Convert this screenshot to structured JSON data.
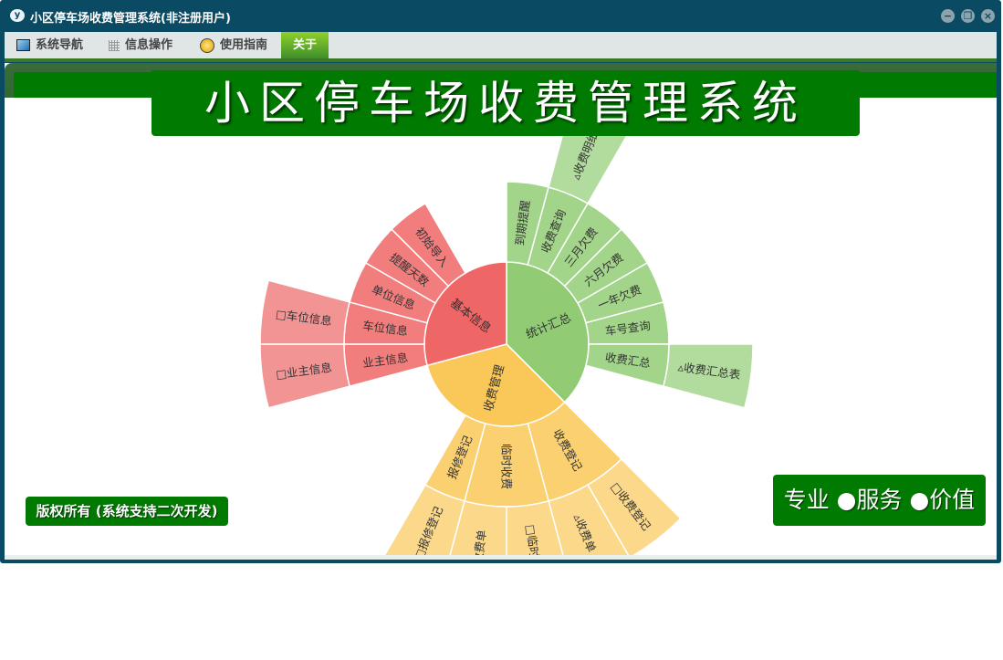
{
  "window": {
    "title": "小区停车场收费管理系统(非注册用户)",
    "controls": [
      "minimize",
      "restore",
      "close"
    ]
  },
  "menu": {
    "items": [
      {
        "label": "系统导航",
        "icon": "monitor-icon"
      },
      {
        "label": "信息操作",
        "icon": "grid-icon"
      },
      {
        "label": "使用指南",
        "icon": "help-icon"
      },
      {
        "label": "关于",
        "active": true
      }
    ]
  },
  "banner": {
    "title": "小区停车场收费管理系统"
  },
  "footer": {
    "copyright": "版权所有 (系统支持二次开发)",
    "slogan": "专业 ●服务 ●价值"
  },
  "chart_data": {
    "type": "sunburst",
    "start": "top, clockwise",
    "nodes": [
      {
        "name": "统计汇总",
        "value": 9,
        "color": "#91cc75",
        "children": [
          {
            "name": "到期提醒",
            "value": 1
          },
          {
            "name": "收费查询",
            "value": 1,
            "children": [
              {
                "name": "▵收费明细",
                "value": 1
              }
            ]
          },
          {
            "name": "三月欠费",
            "value": 1
          },
          {
            "name": "六月欠费",
            "value": 1
          },
          {
            "name": "一年欠费",
            "value": 1
          },
          {
            "name": "车号查询",
            "value": 1
          },
          {
            "name": "收费汇总",
            "value": 1,
            "children": [
              {
                "name": "▵收费汇总表",
                "value": 1
              }
            ]
          }
        ]
      },
      {
        "name": "收费管理",
        "value": 8,
        "color": "#fac858",
        "children": [
          {
            "name": "收费登记",
            "value": 2,
            "children": [
              {
                "name": "□收费登记",
                "value": 1
              },
              {
                "name": "▵收费单",
                "value": 1
              }
            ]
          },
          {
            "name": "临时收费",
            "value": 2,
            "children": [
              {
                "name": "□临时收",
                "value": 1
              },
              {
                "name": "收费单",
                "value": 1
              }
            ]
          },
          {
            "name": "报修登记",
            "value": 1,
            "children": [
              {
                "name": "□报修登记",
                "value": 1
              }
            ]
          }
        ]
      },
      {
        "name": "基本信息",
        "value": 7,
        "color": "#ee6666",
        "children": [
          {
            "name": "业主信息",
            "value": 1,
            "children": [
              {
                "name": "□业主信息",
                "value": 1
              }
            ]
          },
          {
            "name": "车位信息",
            "value": 1,
            "children": [
              {
                "name": "□车位信息",
                "value": 1
              }
            ]
          },
          {
            "name": "单位信息",
            "value": 1
          },
          {
            "name": "提醒天数",
            "value": 1
          },
          {
            "name": "初始导入",
            "value": 1
          }
        ]
      }
    ]
  }
}
